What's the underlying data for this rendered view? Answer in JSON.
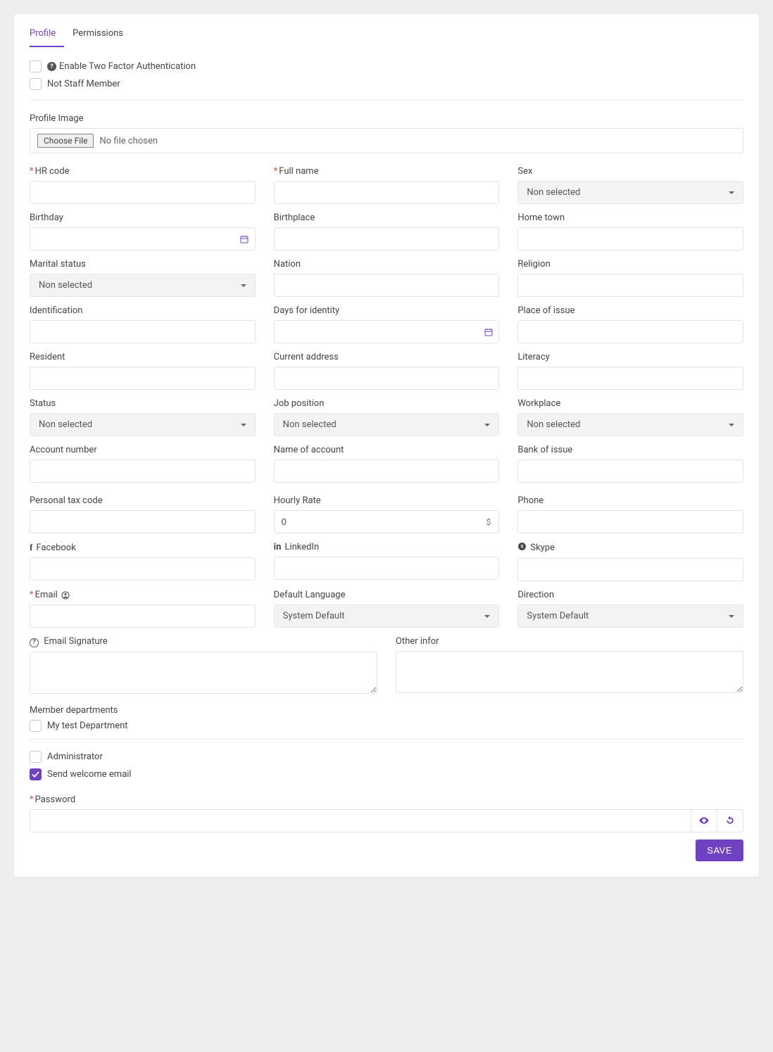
{
  "tabs": {
    "profile": "Profile",
    "permissions": "Permissions"
  },
  "checks": {
    "twofa": "Enable Two Factor Authentication",
    "not_staff": "Not Staff Member",
    "administrator": "Administrator",
    "welcome": "Send welcome email",
    "dept1": "My test Department"
  },
  "profile_image_label": "Profile Image",
  "file": {
    "choose": "Choose File",
    "none": "No file chosen"
  },
  "labels": {
    "hr_code": "HR code",
    "full_name": "Full name",
    "sex": "Sex",
    "birthday": "Birthday",
    "birthplace": "Birthplace",
    "home_town": "Home town",
    "marital": "Marital status",
    "nation": "Nation",
    "religion": "Religion",
    "identification": "Identification",
    "days_identity": "Days for identity",
    "place_issue": "Place of issue",
    "resident": "Resident",
    "curr_address": "Current address",
    "literacy": "Literacy",
    "status": "Status",
    "job_pos": "Job position",
    "workplace": "Workplace",
    "acct_num": "Account number",
    "acct_name": "Name of account",
    "bank_issue": "Bank of issue",
    "tax_code": "Personal tax code",
    "hourly": "Hourly Rate",
    "phone": "Phone",
    "facebook": "Facebook",
    "linkedin": "LinkedIn",
    "skype": "Skype",
    "email": "Email",
    "def_lang": "Default Language",
    "direction": "Direction",
    "email_sig": "Email Signature",
    "other_infor": "Other infor",
    "member_depts": "Member departments",
    "password": "Password"
  },
  "selects": {
    "non_selected": "Non selected",
    "sys_default": "System Default"
  },
  "values": {
    "hourly_rate": "0",
    "currency": "$"
  },
  "save": "SAVE"
}
